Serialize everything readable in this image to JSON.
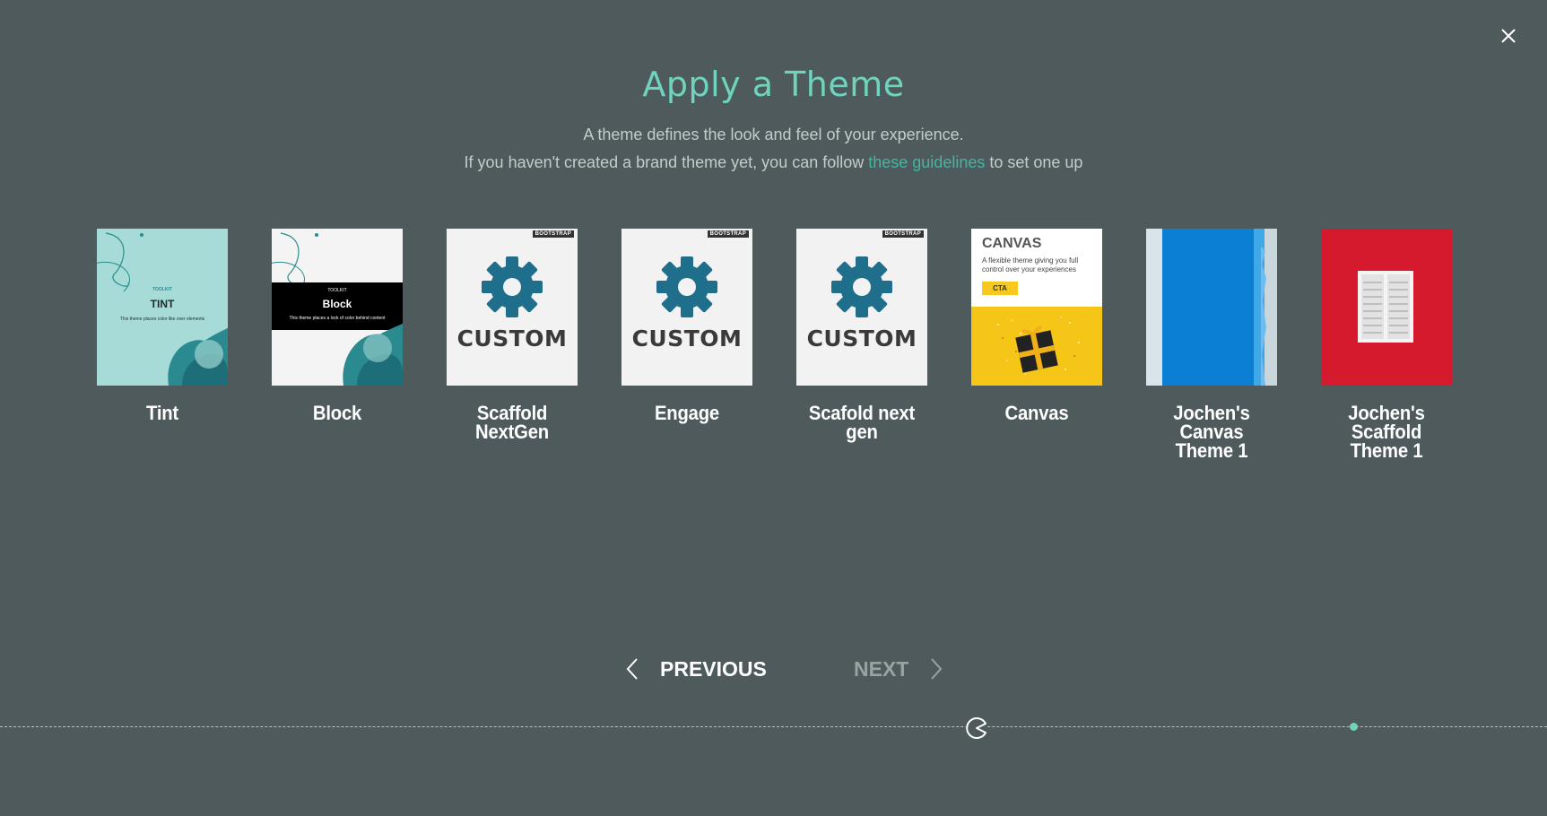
{
  "header": {
    "title": "Apply a Theme",
    "subtitle_line1": "A theme defines the look and feel of your experience.",
    "subtitle_line2_prefix": "If you haven't created a brand theme yet, you can follow ",
    "subtitle_link": "these guidelines",
    "subtitle_line2_suffix": " to set one up"
  },
  "themes": [
    {
      "label": "Tint",
      "thumb_title": "TINT",
      "thumb_small": "TOOLKIT",
      "thumb_caption": "This theme places color like over elements"
    },
    {
      "label": "Block",
      "thumb_title": "Block",
      "thumb_small": "TOOLKIT",
      "thumb_caption": "This theme places a lock of color behind content"
    },
    {
      "label": "Scaffold NextGen",
      "thumb_title": "CUSTOM",
      "thumb_tag": "BOOTSTRAP"
    },
    {
      "label": "Engage",
      "thumb_title": "CUSTOM",
      "thumb_tag": "BOOTSTRAP"
    },
    {
      "label": "Scafold next gen",
      "thumb_title": "CUSTOM",
      "thumb_tag": "BOOTSTRAP"
    },
    {
      "label": "Canvas",
      "thumb_title": "CANVAS",
      "thumb_caption": "A flexible theme giving you full control over your experiences",
      "thumb_cta": "CTA"
    },
    {
      "label": "Jochen's Canvas Theme 1"
    },
    {
      "label": "Jochen's Scaffold Theme 1"
    }
  ],
  "navigation": {
    "previous_label": "PREVIOUS",
    "next_label": "NEXT"
  },
  "colors": {
    "background": "#4f5a5c",
    "accent": "#6fd3bd",
    "gear": "#1f6e8c"
  }
}
